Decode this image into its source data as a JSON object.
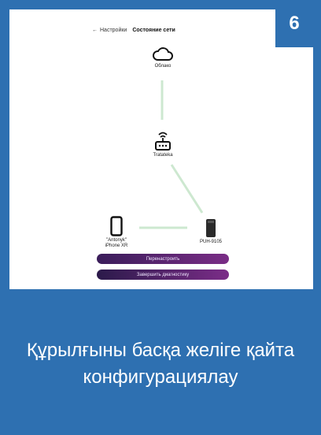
{
  "header": {
    "back_label": "Настройки",
    "title": "Состояние сети"
  },
  "step_badge": "6",
  "nodes": {
    "cloud": {
      "label": "Облако",
      "icon": "cloud-icon"
    },
    "router": {
      "label": "Tratateka",
      "icon": "router-icon"
    },
    "phone": {
      "label_line1": "\"Antonyk\"",
      "label_line2": "iPhone XR",
      "icon": "phone-icon"
    },
    "purifier": {
      "label": "PUH-9105",
      "icon": "device-icon"
    }
  },
  "buttons": {
    "reconfigure": "Перенастроить",
    "finish": "Завершить диагностику"
  },
  "caption": "Құрылғыны басқа желіге қайта конфигурациялау",
  "colors": {
    "frame_blue": "#2e70b1",
    "link_line": "#cde8d0",
    "button_start": "#3a1d5a",
    "button_end": "#7a2d86"
  }
}
